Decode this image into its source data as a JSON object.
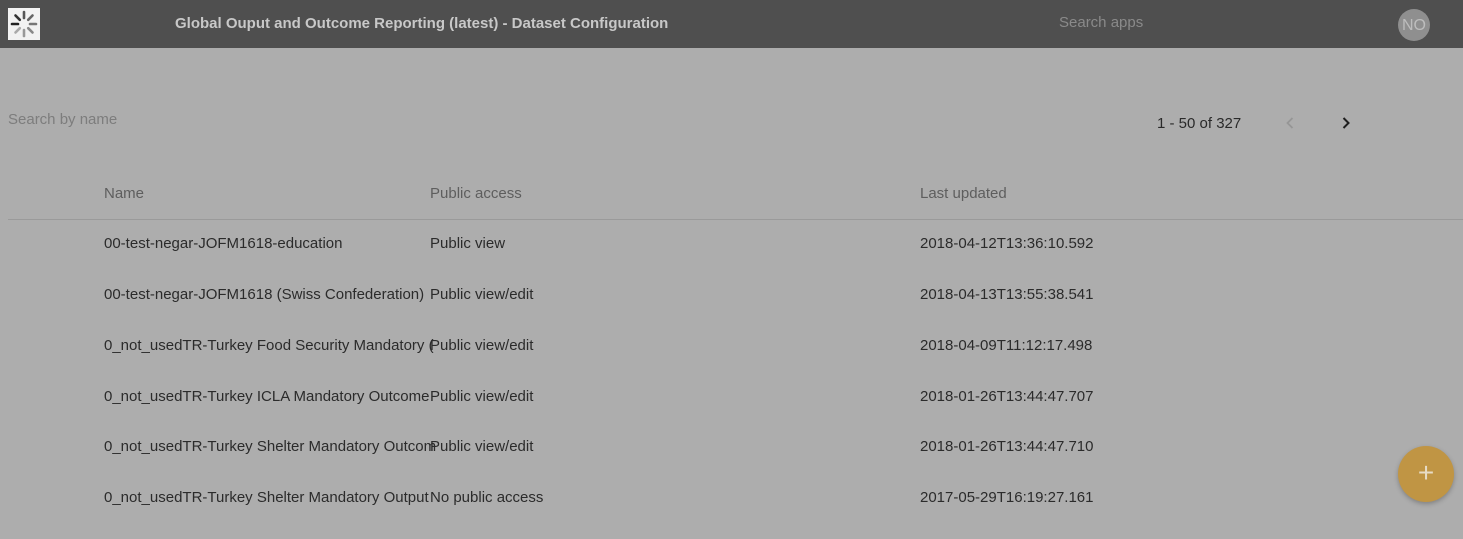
{
  "header": {
    "title": "Global Ouput and Outcome Reporting (latest) - Dataset Configuration",
    "search_placeholder": "Search apps",
    "avatar_initials": "NO"
  },
  "toolbar": {
    "search_placeholder": "Search by name",
    "pager_text": "1 - 50 of 327"
  },
  "table": {
    "columns": [
      "Name",
      "Public access",
      "Last updated"
    ],
    "rows": [
      [
        "00-test-negar-JOFM1618-education",
        "Public view",
        "2018-04-12T13:36:10.592"
      ],
      [
        "00-test-negar-JOFM1618 (Swiss Confederation)",
        "Public view/edit",
        "2018-04-13T13:55:38.541"
      ],
      [
        "0_not_usedTR-Turkey Food Security Mandatory (",
        "Public view/edit",
        "2018-04-09T11:12:17.498"
      ],
      [
        "0_not_usedTR-Turkey ICLA Mandatory Outcome",
        "Public view/edit",
        "2018-01-26T13:44:47.707"
      ],
      [
        "0_not_usedTR-Turkey Shelter Mandatory Outcom",
        "Public view/edit",
        "2018-01-26T13:44:47.710"
      ],
      [
        "0_not_usedTR-Turkey Shelter Mandatory Output",
        "No public access",
        "2017-05-29T16:19:27.161"
      ]
    ]
  },
  "fab": {
    "label": "+"
  },
  "colors": {
    "topbar": "#4f4f4f",
    "overlay": "#adadad",
    "fab": "#c09544"
  }
}
